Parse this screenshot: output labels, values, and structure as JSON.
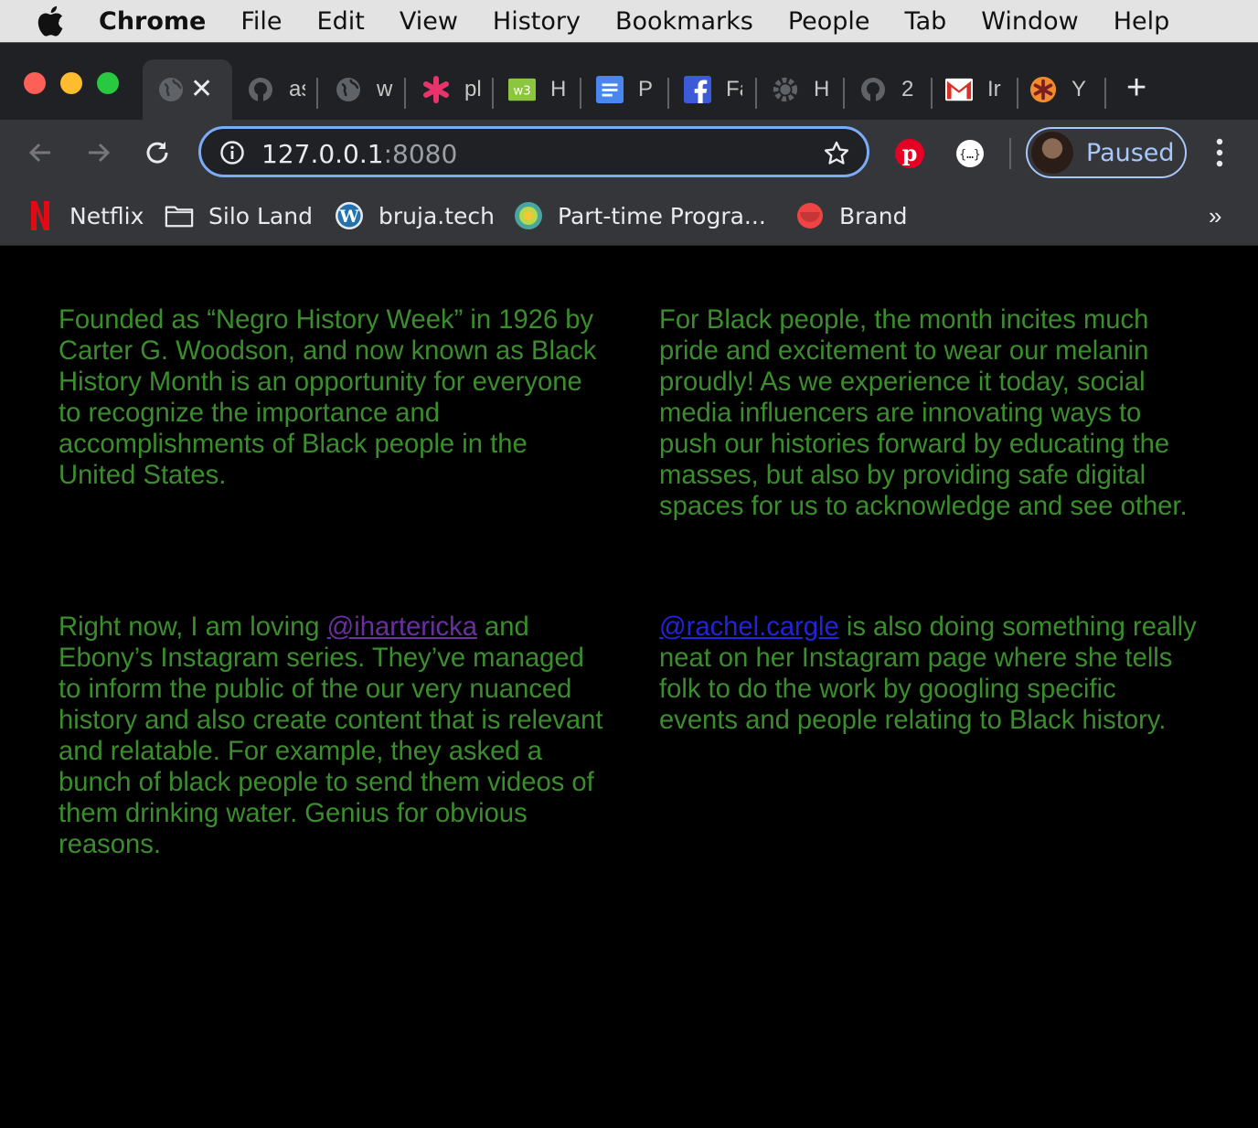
{
  "menubar": {
    "app_name": "Chrome",
    "items": [
      "File",
      "Edit",
      "View",
      "History",
      "Bookmarks",
      "People",
      "Tab",
      "Window",
      "Help"
    ]
  },
  "tabs": [
    {
      "title": "",
      "icon": "globe-icon",
      "active": true
    },
    {
      "title": "as",
      "icon": "github-icon"
    },
    {
      "title": "w",
      "icon": "globe-icon"
    },
    {
      "title": "pl",
      "icon": "asterisk-icon"
    },
    {
      "title": "H",
      "icon": "w3-icon"
    },
    {
      "title": "P",
      "icon": "docs-icon"
    },
    {
      "title": "Fa",
      "icon": "facebook-icon"
    },
    {
      "title": "H",
      "icon": "settings-icon"
    },
    {
      "title": "2",
      "icon": "github-icon"
    },
    {
      "title": "Ir",
      "icon": "gmail-icon"
    },
    {
      "title": "Y",
      "icon": "asterisk-orange-icon"
    }
  ],
  "address_bar": {
    "host": "127.0.0.1",
    "port": ":8080"
  },
  "profile": {
    "label": "Paused"
  },
  "bookmarks": [
    {
      "label": "Netflix",
      "icon": "netflix-icon"
    },
    {
      "label": "Silo Land",
      "icon": "folder-icon"
    },
    {
      "label": "bruja.tech",
      "icon": "wordpress-icon"
    },
    {
      "label": "Part-time Progra...",
      "icon": "circle-logo-icon"
    },
    {
      "label": "Brand",
      "icon": "brand-icon"
    }
  ],
  "bookmarks_more": "»",
  "content": {
    "p1": "Founded as “Negro History Week” in 1926 by Carter G. Woodson, and now known as Black History Month is an opportunity for everyone to recognize the importance and accomplishments of Black people in the United States.",
    "p2": "For Black people, the month incites much pride and excitement to wear our melanin proudly! As we experience it today, social media influencers are innovating ways to push our histories forward by educating the masses, but also by providing safe digital spaces for us to acknowledge and see other.",
    "p3_before": "Right now, I am loving ",
    "p3_link": "@ihartericka",
    "p3_after": " and Ebony’s Instagram series. They’ve managed to inform the public of the our very nuanced history and also create content that is relevant and relatable. For example, they asked a bunch of black people to send them videos of them drinking water. Genius for obvious reasons.",
    "p4_link": "@rachel.cargle",
    "p4_after": " is also doing something really neat on her Instagram page where she tells folk to do the work by googling specific events and people relating to Black history."
  },
  "colors": {
    "text_green": "#3b8d2d",
    "visited_link": "#6b2fa0",
    "link": "#2323d9",
    "background": "#000000"
  }
}
